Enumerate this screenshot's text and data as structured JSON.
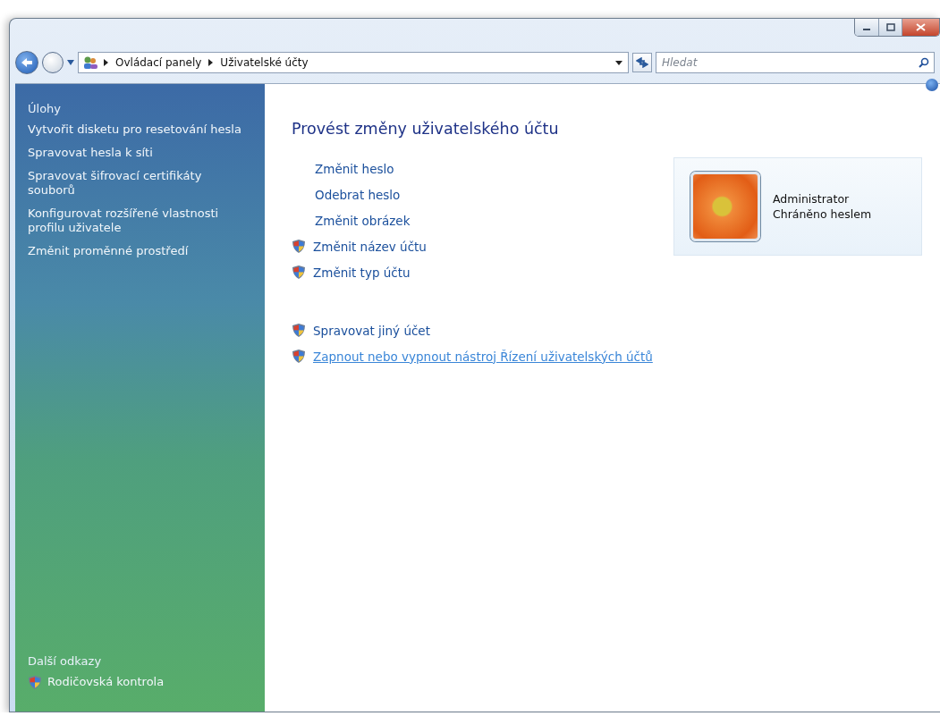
{
  "address_bar": {
    "breadcrumbs": [
      "Ovládací panely",
      "Uživatelské účty"
    ]
  },
  "search": {
    "placeholder": "Hledat"
  },
  "sidebar": {
    "heading": "Úlohy",
    "items": [
      {
        "label": "Vytvořit disketu pro resetování hesla",
        "shield": false
      },
      {
        "label": "Spravovat hesla k síti",
        "shield": false
      },
      {
        "label": "Spravovat šifrovací certifikáty souborů",
        "shield": false
      },
      {
        "label": "Konfigurovat rozšířené vlastnosti profilu uživatele",
        "shield": false
      },
      {
        "label": "Změnit proměnné prostředí",
        "shield": false
      }
    ],
    "see_also_heading": "Další odkazy",
    "see_also": [
      {
        "label": "Rodičovská kontrola",
        "shield": true
      }
    ]
  },
  "content": {
    "title": "Provést změny uživatelského účtu",
    "groups": [
      [
        {
          "label": "Změnit heslo",
          "shield": false,
          "hovered": false
        },
        {
          "label": "Odebrat heslo",
          "shield": false,
          "hovered": false
        },
        {
          "label": "Změnit obrázek",
          "shield": false,
          "hovered": false
        },
        {
          "label": "Změnit název účtu",
          "shield": true,
          "hovered": false
        },
        {
          "label": "Změnit typ účtu",
          "shield": true,
          "hovered": false
        }
      ],
      [
        {
          "label": "Spravovat jiný účet",
          "shield": true,
          "hovered": false
        },
        {
          "label": "Zapnout nebo vypnout nástroj Řízení uživatelských účtů",
          "shield": true,
          "hovered": true
        }
      ]
    ],
    "account": {
      "name": "Administrator",
      "status": "Chráněno heslem"
    }
  }
}
